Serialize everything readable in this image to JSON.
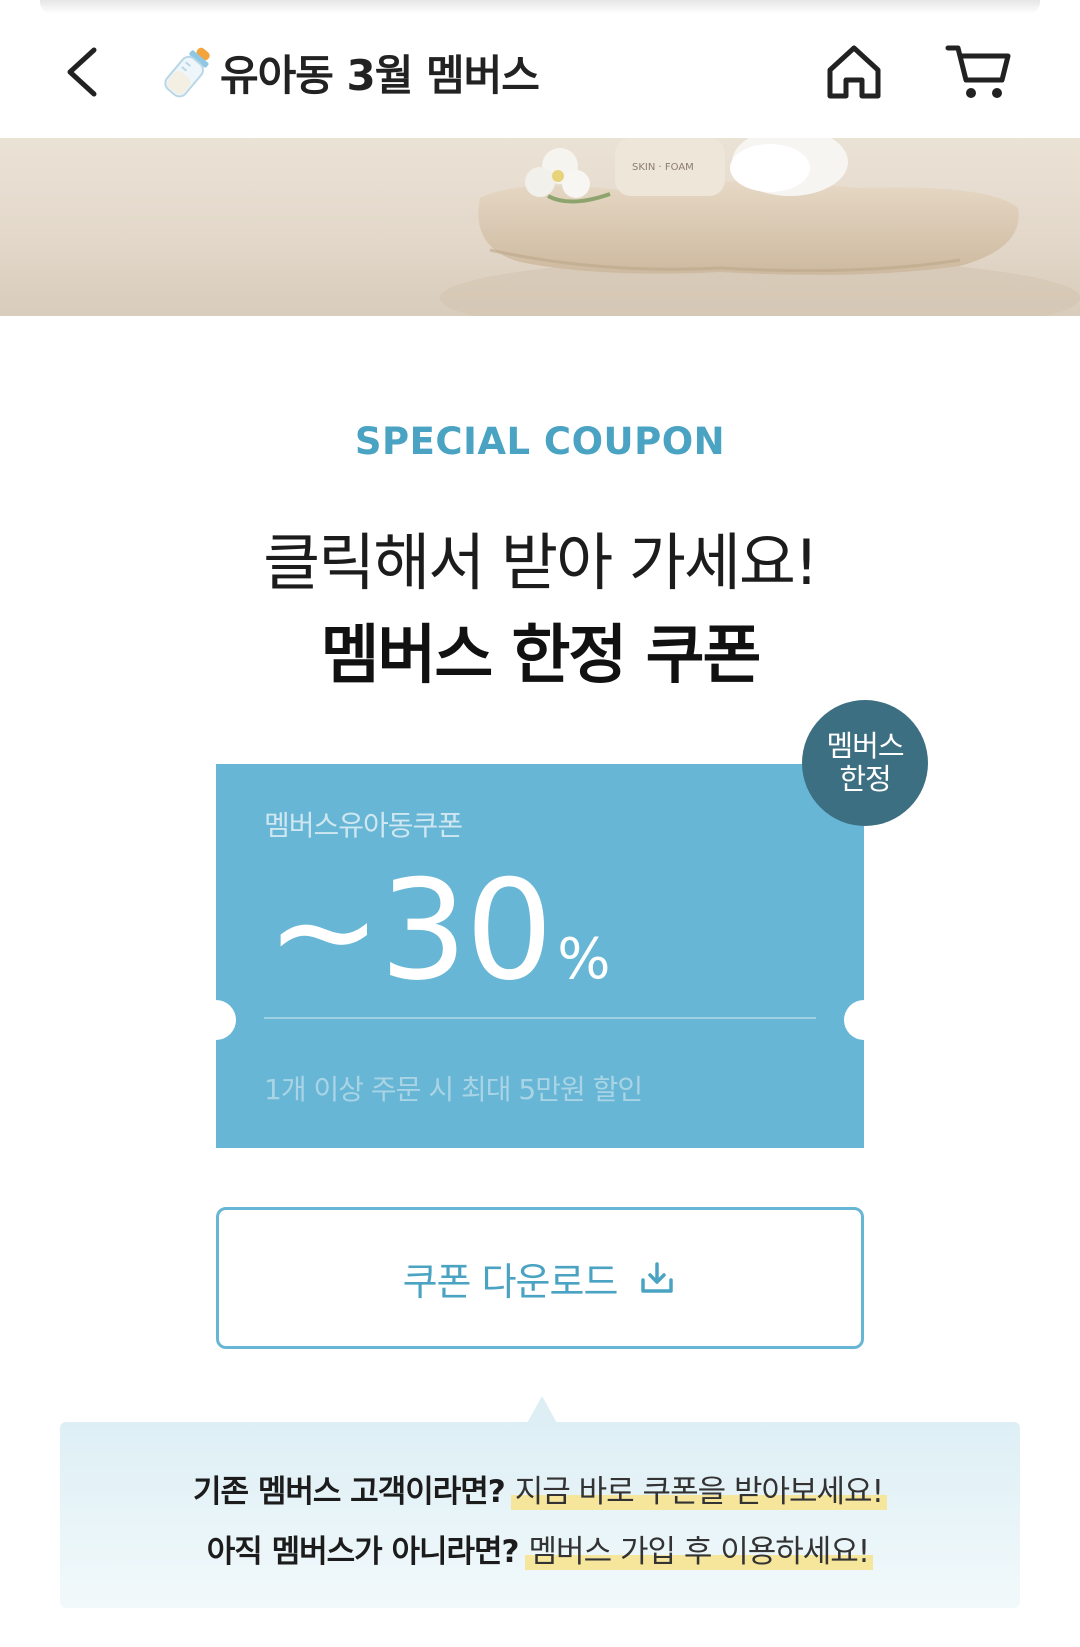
{
  "header": {
    "title": "유아동 3월 멤버스",
    "icons": {
      "back": "chevron-left-icon",
      "title": "baby-bottle-icon",
      "home": "home-icon",
      "cart": "cart-icon"
    }
  },
  "section": {
    "label": "SPECIAL COUPON",
    "headline_line1": "클릭해서 받아 가세요!",
    "headline_line2": "멤버스 한정 쿠폰"
  },
  "coupon": {
    "name": "멤버스유아동쿠폰",
    "value": "~30",
    "unit": "%",
    "description": "1개 이상 주문 시 최대 5만원 할인",
    "badge_line1": "멤버스",
    "badge_line2": "한정"
  },
  "download": {
    "label": "쿠폰 다운로드",
    "icon": "download-icon"
  },
  "info": {
    "line1_question": "기존 멤버스 고객이라면?",
    "line1_highlight": "지금 바로 쿠폰을 받아보세요!",
    "line2_question": "아직 멤버스가 아니라면?",
    "line2_highlight": "멤버스 가입 후 이용하세요!"
  },
  "colors": {
    "accent": "#4aa3c2",
    "coupon_bg": "#67b6d5",
    "badge_bg": "#3d6f82",
    "highlight": "#f6e69b"
  }
}
